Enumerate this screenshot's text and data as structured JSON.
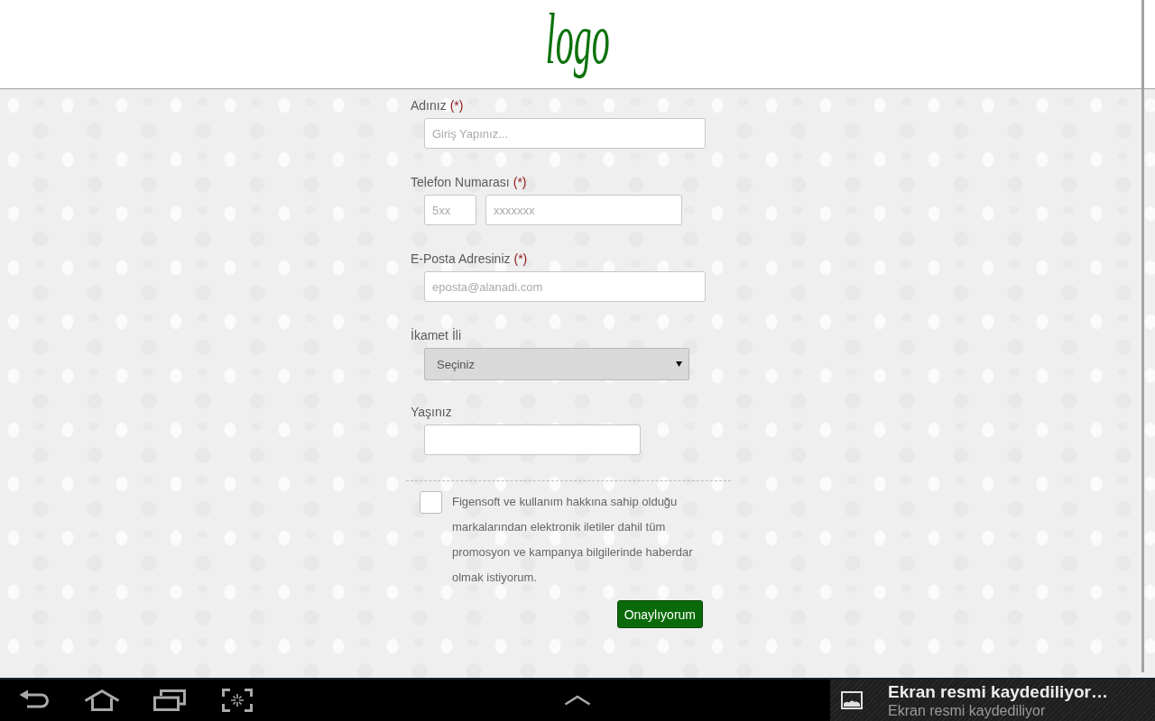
{
  "header": {
    "logo": "logo"
  },
  "form": {
    "fields": [
      {
        "kind": "text",
        "label": "Adınız",
        "required_mark": "(*)",
        "inputs": [
          {
            "placeholder": "Giriş Yapınız..."
          }
        ]
      },
      {
        "kind": "phone",
        "label": "Telefon Numarası",
        "required_mark": "(*)",
        "inputs": [
          {
            "placeholder": "5xx"
          },
          {
            "placeholder": "xxxxxxx"
          }
        ]
      },
      {
        "kind": "text",
        "label": "E-Posta Adresiniz",
        "required_mark": "(*)",
        "inputs": [
          {
            "placeholder": "eposta@alanadi.com"
          }
        ]
      },
      {
        "kind": "select",
        "label": "İkamet İli",
        "value": "Seçiniz"
      },
      {
        "kind": "number",
        "label": "Yaşınız"
      }
    ],
    "consent": {
      "checked": false,
      "text": "Figensoft ve kullanım hakkına sahip olduğu markalarından elektronik iletiler dahil tüm promosyon ve kampanya bilgilerinde haberdar olmak istiyorum."
    },
    "submit_button": "Onaylıyorum"
  },
  "notification": {
    "title": "Ekran resmi kaydediliyor…",
    "text": "Ekran resmi kaydediliyor"
  }
}
